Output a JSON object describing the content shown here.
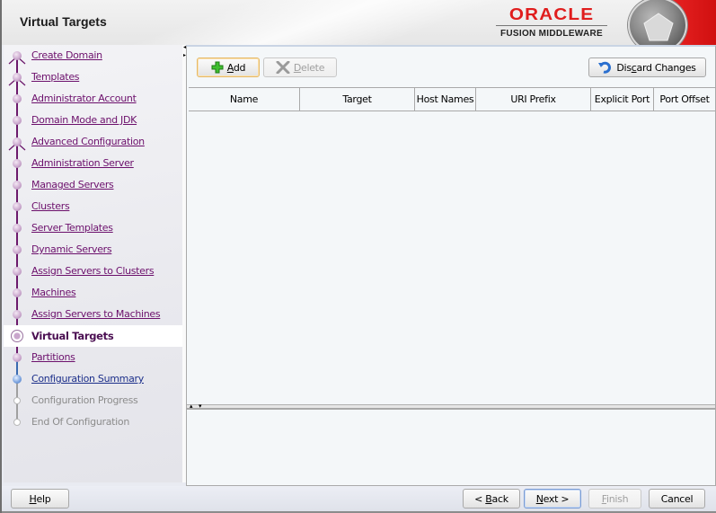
{
  "header": {
    "title": "Virtual Targets",
    "brand_name": "ORACLE",
    "brand_product": "FUSION MIDDLEWARE"
  },
  "nav": {
    "items": [
      {
        "label": "Create Domain",
        "state": "done",
        "fork": true
      },
      {
        "label": "Templates",
        "state": "done",
        "fork": true
      },
      {
        "label": "Administrator Account",
        "state": "done",
        "fork": false
      },
      {
        "label": "Domain Mode and JDK",
        "state": "done",
        "fork": false
      },
      {
        "label": "Advanced Configuration",
        "state": "done",
        "fork": true
      },
      {
        "label": "Administration Server",
        "state": "done",
        "fork": false
      },
      {
        "label": "Managed Servers",
        "state": "done",
        "fork": false
      },
      {
        "label": "Clusters",
        "state": "done",
        "fork": false
      },
      {
        "label": "Server Templates",
        "state": "done",
        "fork": false
      },
      {
        "label": "Dynamic Servers",
        "state": "done",
        "fork": false
      },
      {
        "label": "Assign Servers to Clusters",
        "state": "done",
        "fork": false
      },
      {
        "label": "Machines",
        "state": "done",
        "fork": false
      },
      {
        "label": "Assign Servers to Machines",
        "state": "done",
        "fork": false
      },
      {
        "label": "Virtual Targets",
        "state": "current",
        "fork": false
      },
      {
        "label": "Partitions",
        "state": "done",
        "fork": false
      },
      {
        "label": "Configuration Summary",
        "state": "next",
        "fork": false
      },
      {
        "label": "Configuration Progress",
        "state": "pending",
        "fork": false
      },
      {
        "label": "End Of Configuration",
        "state": "pending",
        "fork": false
      }
    ]
  },
  "toolbar": {
    "add_label": "Add",
    "add_mnemonic": "A",
    "delete_label": "Delete",
    "delete_mnemonic": "D",
    "discard_label": "Discard Changes",
    "discard_pre": "Dis",
    "discard_mnemonic": "c",
    "discard_post": "ard Changes"
  },
  "table": {
    "columns": [
      "Name",
      "Target",
      "Host Names",
      "URI Prefix",
      "Explicit Port",
      "Port Offset"
    ],
    "rows": []
  },
  "footer": {
    "help_label": "Help",
    "back_label": "< Back",
    "next_label": "Next >",
    "finish_label": "Finish",
    "cancel_label": "Cancel"
  },
  "colors": {
    "brand_red": "#e01d1d",
    "nav_link": "#6c106c",
    "nav_next": "#1c2f8a",
    "nav_pending": "#8c8c8c",
    "focus_border": "#e5b968"
  }
}
